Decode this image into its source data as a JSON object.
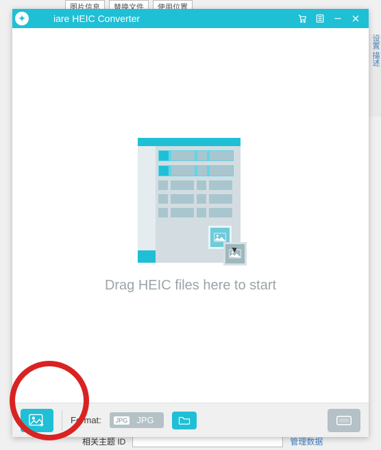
{
  "background": {
    "tabs": [
      "图片信息",
      "替换文件",
      "使用位置"
    ],
    "side_text": "设置\n描述",
    "bottom_label": "相关主题 ID",
    "bottom_link": "管理数据"
  },
  "titlebar": {
    "app_name_visible": "iare HEIC Converter",
    "icons": {
      "cart": "cart-icon",
      "list": "list-icon",
      "minimize": "minimize-icon",
      "close": "close-icon"
    }
  },
  "dropzone": {
    "prompt": "Drag HEIC files here to start"
  },
  "bottombar": {
    "add_button": "add-image",
    "format_label": "Format:",
    "format_badge": "JPG",
    "format_value": "JPG",
    "open_folder": "open-folder",
    "start_button": "start-convert"
  },
  "annotation": {
    "highlight": "add-image-button"
  }
}
